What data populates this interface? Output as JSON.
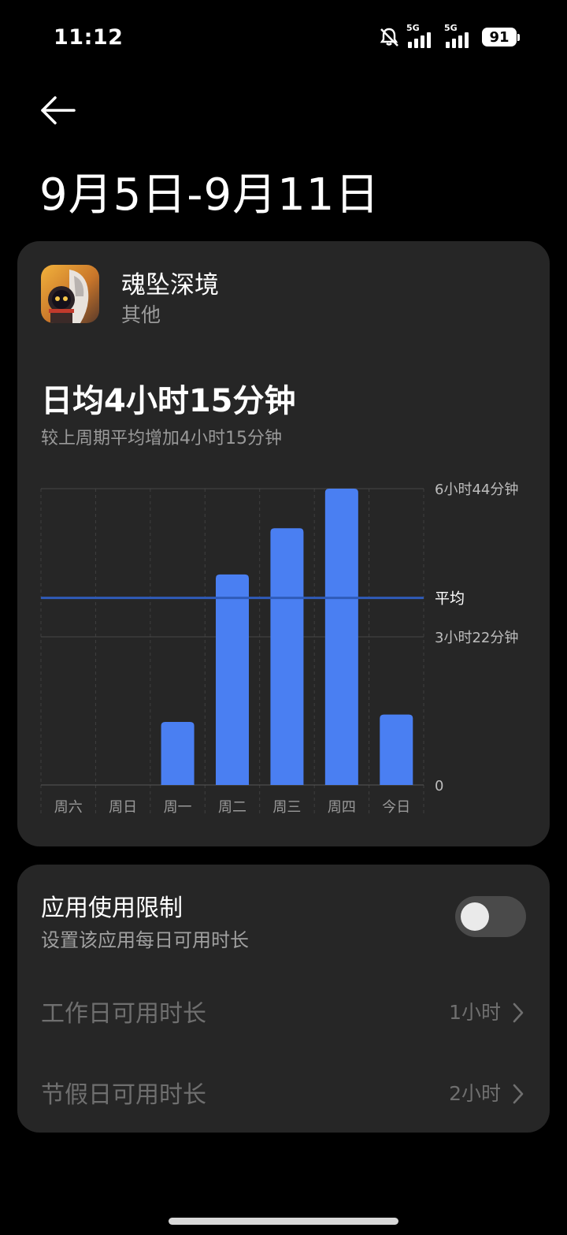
{
  "status_bar": {
    "time": "11:12",
    "sim1": "5G",
    "sim2": "5G",
    "battery": "91"
  },
  "header": {
    "title": "9月5日-9月11日"
  },
  "app": {
    "name": "魂坠深境",
    "category": "其他"
  },
  "summary": {
    "daily_average": "日均4小时15分钟",
    "comparison": "较上周期平均增加4小时15分钟"
  },
  "chart_data": {
    "type": "bar",
    "categories": [
      "周六",
      "周日",
      "周一",
      "周二",
      "周三",
      "周四",
      "今日"
    ],
    "values": [
      0,
      0,
      86,
      287,
      350,
      404,
      96
    ],
    "y_unit": "minutes",
    "ylim": [
      0,
      404
    ],
    "y_ticks": [
      {
        "value": 404,
        "label": "6小时44分钟"
      },
      {
        "value": 202,
        "label": "3小时22分钟"
      },
      {
        "value": 0,
        "label": "0"
      }
    ],
    "average": {
      "value": 255,
      "label": "平均"
    },
    "colors": {
      "bar": "#4a7ff2",
      "average_line": "#2f5bb8",
      "grid": "#454545"
    }
  },
  "limit": {
    "title": "应用使用限制",
    "subtitle": "设置该应用每日可用时长",
    "enabled": false,
    "workday_label": "工作日可用时长",
    "workday_value": "1小时",
    "holiday_label": "节假日可用时长",
    "holiday_value": "2小时"
  }
}
